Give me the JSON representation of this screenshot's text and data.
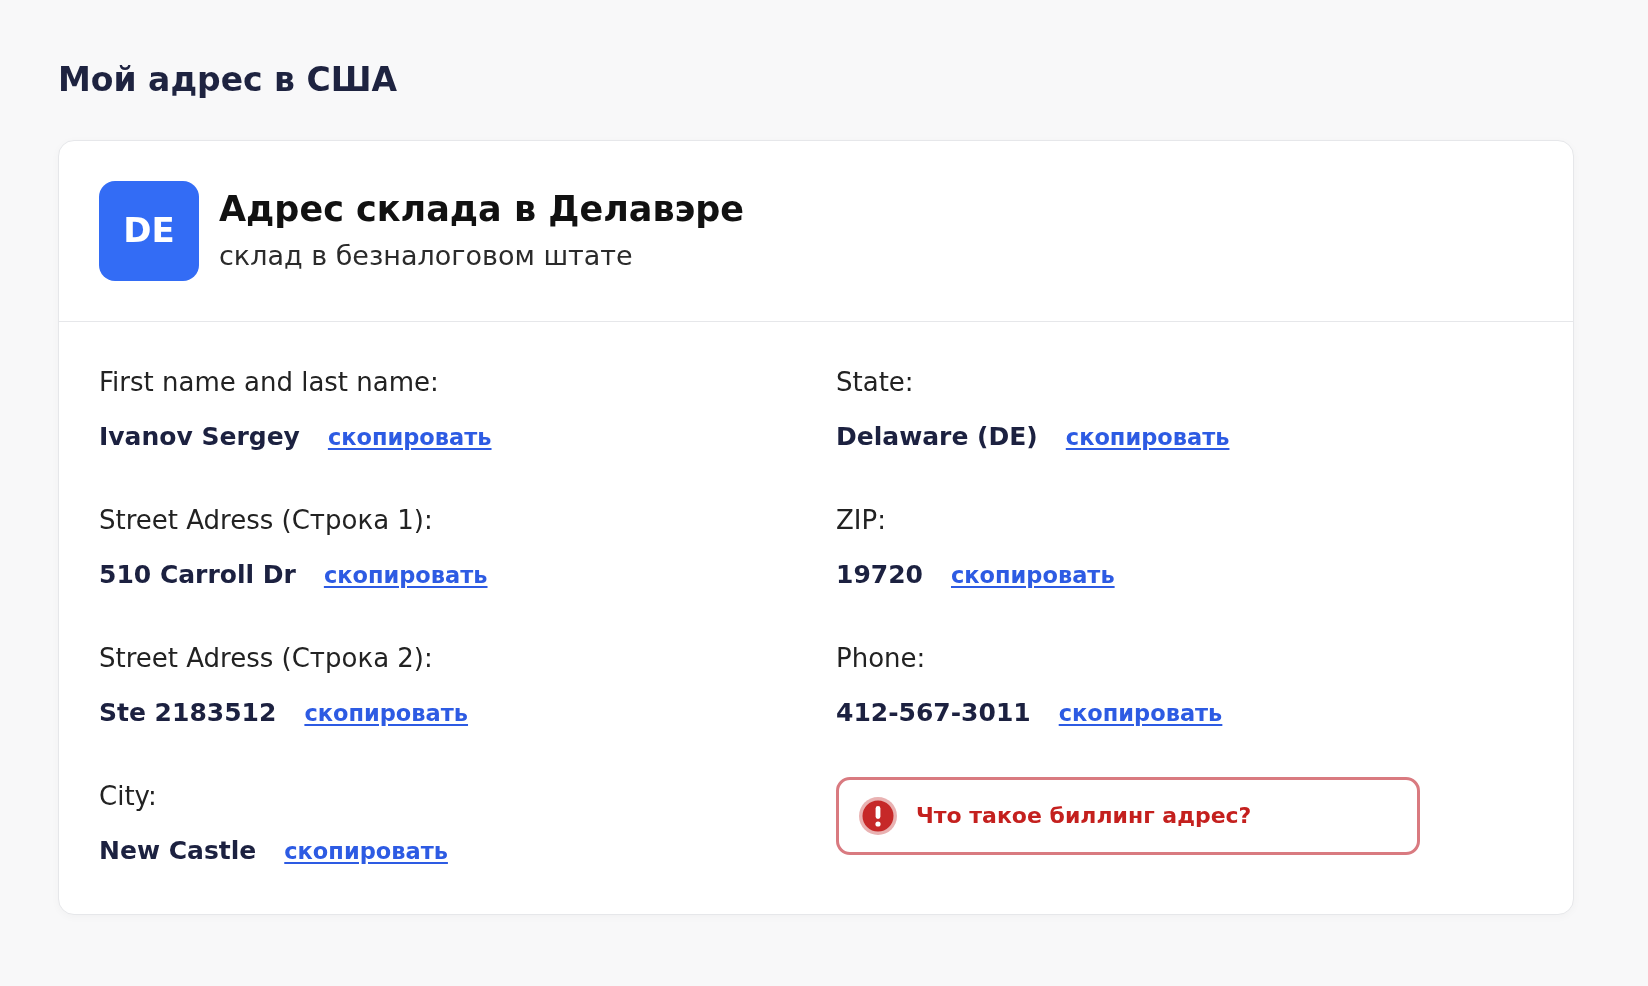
{
  "page_title": "Мой адрес в США",
  "warehouse": {
    "badge": "DE",
    "title": "Адрес склада в Делавэре",
    "subtitle": "склад в безналоговом штате"
  },
  "columns": [
    {
      "fields": [
        {
          "label": "First name and last name:",
          "value": "Ivanov Sergey",
          "action": "скопировать"
        },
        {
          "label": "Street Adress (Строка 1):",
          "value": "510 Carroll Dr",
          "action": "скопировать"
        },
        {
          "label": "Street Adress (Строка 2):",
          "value": "Ste 2183512",
          "action": "скопировать"
        },
        {
          "label": "City:",
          "value": "New Castle",
          "action": "скопировать"
        }
      ]
    },
    {
      "fields": [
        {
          "label": "State:",
          "value": "Delaware (DE)",
          "action": "скопировать"
        },
        {
          "label": "ZIP:",
          "value": "19720",
          "action": "скопировать"
        },
        {
          "label": "Phone:",
          "value": "412-567-3011",
          "action": "скопировать"
        }
      ],
      "notice": {
        "text": "Что такое биллинг адрес?"
      }
    }
  ]
}
